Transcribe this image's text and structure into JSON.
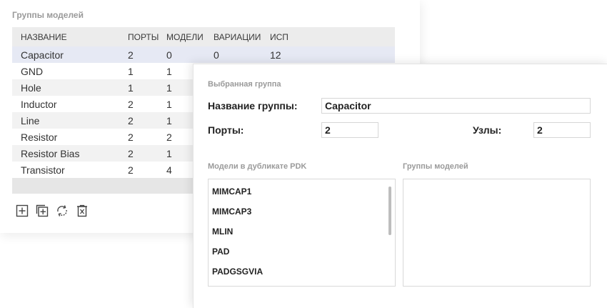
{
  "groups_panel": {
    "title": "Группы моделей",
    "columns": [
      "НАЗВАНИЕ",
      "ПОРТЫ",
      "МОДЕЛИ",
      "ВАРИАЦИИ",
      "ИСП"
    ],
    "rows": [
      {
        "name": "Capacitor",
        "ports": "2",
        "models": "0",
        "variations": "0",
        "usage": "12"
      },
      {
        "name": "GND",
        "ports": "1",
        "models": "1",
        "variations": "",
        "usage": ""
      },
      {
        "name": "Hole",
        "ports": "1",
        "models": "1",
        "variations": "",
        "usage": ""
      },
      {
        "name": "Inductor",
        "ports": "2",
        "models": "1",
        "variations": "",
        "usage": ""
      },
      {
        "name": "Line",
        "ports": "2",
        "models": "1",
        "variations": "",
        "usage": ""
      },
      {
        "name": "Resistor",
        "ports": "2",
        "models": "2",
        "variations": "",
        "usage": ""
      },
      {
        "name": "Resistor Bias",
        "ports": "2",
        "models": "1",
        "variations": "",
        "usage": ""
      },
      {
        "name": "Transistor",
        "ports": "2",
        "models": "4",
        "variations": "",
        "usage": ""
      }
    ],
    "toolbar_icons": [
      "add-icon",
      "add-copy-icon",
      "refresh-icon",
      "delete-icon"
    ]
  },
  "selected_group": {
    "title": "Выбранная группа",
    "name_label": "Название группы:",
    "name_value": "Capacitor",
    "ports_label": "Порты:",
    "ports_value": "2",
    "nodes_label": "Узлы:",
    "nodes_value": "2",
    "pdk_models_title": "Модели в дубликате PDK",
    "pdk_models": [
      "MIMCAP1",
      "MIMCAP3",
      "MLIN",
      "PAD",
      "PADGSGVIA"
    ],
    "group_models_title": "Группы моделей",
    "group_models": []
  }
}
